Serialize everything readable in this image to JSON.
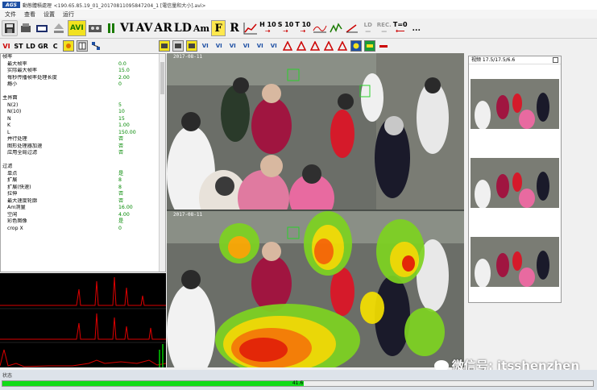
{
  "window": {
    "logo_text": "AGS",
    "app_name": "動態體積處理",
    "title": "<190.65.85.19_01_20170811095847204_1 [電信量和大小].avi>"
  },
  "menu": [
    "文件",
    "查看",
    "设置",
    "运行"
  ],
  "toolbar1": {
    "avi": "AVI",
    "vi": "VI",
    "av": "AV",
    "ar": "AR",
    "ld": "LD",
    "am": "Am",
    "f": "F",
    "r": "R",
    "h10_top": "H 10",
    "s10_top": "S 10",
    "t10_top": "T 10",
    "ld_gray": "LD",
    "rec_gray": "REC.",
    "t0": "T=0",
    "ellipsis": "..."
  },
  "toolbar2": {
    "vi": "VI",
    "st": "ST",
    "ld": "LD",
    "gr": "GR",
    "c": "C"
  },
  "properties": [
    {
      "key": "帧率",
      "value": "",
      "section": true
    },
    {
      "key": "最大帧率",
      "value": "0.0"
    },
    {
      "key": "实际最大帧率",
      "value": "15.0"
    },
    {
      "key": "每秒传播帧率处理长度",
      "value": "2.00"
    },
    {
      "key": "瘾小",
      "value": "0"
    },
    {
      "key": "",
      "value": "",
      "gap": true
    },
    {
      "key": "主界面",
      "value": "",
      "section": true
    },
    {
      "key": "N(2)",
      "value": "5"
    },
    {
      "key": "N(10)",
      "value": "10"
    },
    {
      "key": "N",
      "value": "15"
    },
    {
      "key": "K",
      "value": "1.00"
    },
    {
      "key": "L",
      "value": "150.00"
    },
    {
      "key": "并行处理",
      "value": "否"
    },
    {
      "key": "图形处理器加速",
      "value": "否"
    },
    {
      "key": "应用全局过滤",
      "value": "否"
    },
    {
      "key": "",
      "value": "",
      "gap": true
    },
    {
      "key": "过滤",
      "value": "",
      "section": true
    },
    {
      "key": "单点",
      "value": "是"
    },
    {
      "key": "扩展",
      "value": "8"
    },
    {
      "key": "扩展(快速)",
      "value": "8"
    },
    {
      "key": "拉伸",
      "value": "否"
    },
    {
      "key": "最大速度轮廓",
      "value": "否"
    },
    {
      "key": "Am测量",
      "value": "16.00"
    },
    {
      "key": "空闲",
      "value": "4.00"
    },
    {
      "key": "彩色图像",
      "value": "是"
    },
    {
      "key": "crop X",
      "value": "0"
    }
  ],
  "video": {
    "timestamp_top": "2017-08-11",
    "timestamp_bottom": "2017-08-11"
  },
  "thumbs_panel": {
    "title": "视频 17.5/17.5/6.6"
  },
  "status": {
    "label": "状态",
    "progress_text": "41.6",
    "progress": 0.51
  },
  "watermark": "微信号: itsshenzhen"
}
